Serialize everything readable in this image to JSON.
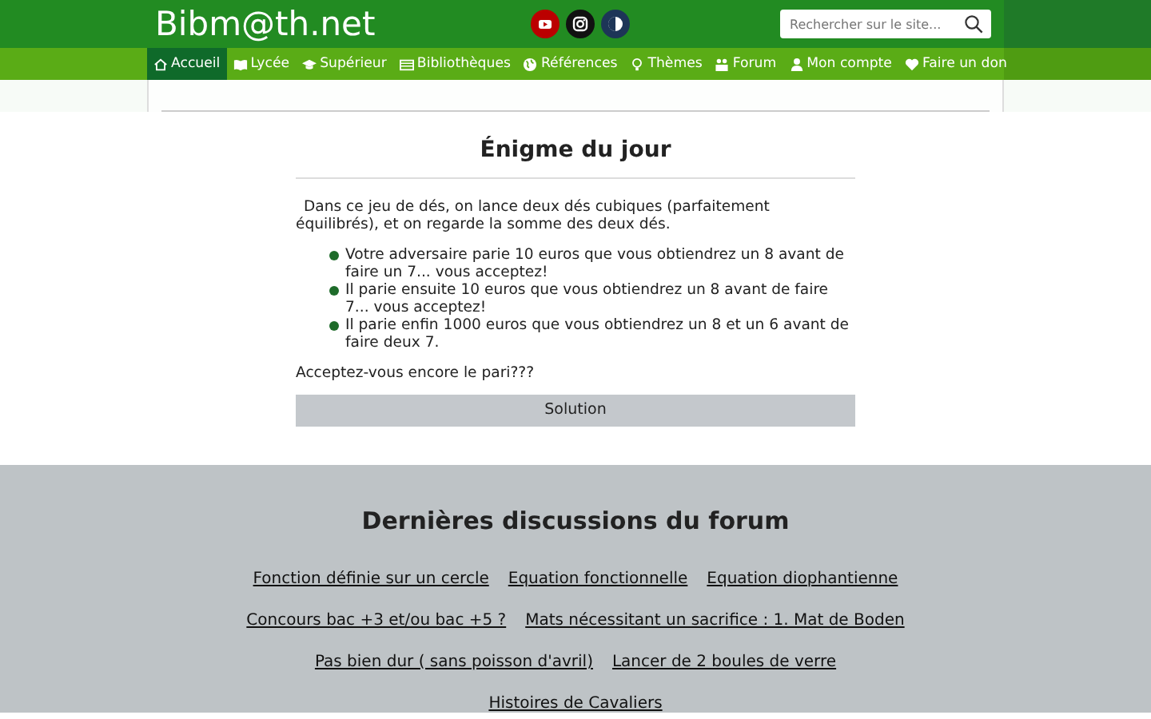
{
  "header": {
    "logo": "Bibm@th.net",
    "social": [
      {
        "kind": "youtube"
      },
      {
        "kind": "instagram"
      },
      {
        "kind": "other"
      }
    ],
    "search": {
      "placeholder": "Rechercher sur le site..."
    }
  },
  "nav": {
    "left": [
      {
        "label": "Accueil",
        "selected": true
      },
      {
        "label": "Lycée",
        "selected": false
      },
      {
        "label": "Supérieur",
        "selected": false
      },
      {
        "label": "Bibliothèques",
        "selected": false
      },
      {
        "label": "Références",
        "selected": false
      },
      {
        "label": "Thèmes",
        "selected": false
      },
      {
        "label": "Forum",
        "selected": false
      }
    ],
    "right": [
      {
        "label": "Mon compte",
        "selected": false
      },
      {
        "label": "Faire un don",
        "selected": false
      }
    ]
  },
  "enigme": {
    "title": "Énigme du jour",
    "intro": "Dans ce jeu de dés, on lance deux dés cubiques (parfaitement équilibrés), et on regarde la somme des deux dés.",
    "bullets": [
      "Votre adversaire parie 10 euros que vous obtiendrez un 8 avant de faire un 7... vous acceptez!",
      "Il parie ensuite 10 euros que vous obtiendrez un 8 avant de faire 7... vous acceptez!",
      "Il parie enfin 1000 euros que vous obtiendrez un 8 et un 6 avant de faire deux 7."
    ],
    "question": "Acceptez-vous encore le pari???",
    "button": "Solution"
  },
  "forum": {
    "title": "Dernières discussions du forum",
    "rows": [
      [
        "Fonction définie sur un cercle",
        "Equation fonctionnelle",
        "Equation diophantienne"
      ],
      [
        "Concours bac +3 et/ou bac +5 ?",
        "Mats nécessitant un sacrifice : 1. Mat de Boden"
      ],
      [
        "Pas bien dur ( sans poisson d'avril)",
        "Lancer de 2 boules de verre"
      ],
      [
        "Histoires de Cavaliers"
      ]
    ]
  }
}
